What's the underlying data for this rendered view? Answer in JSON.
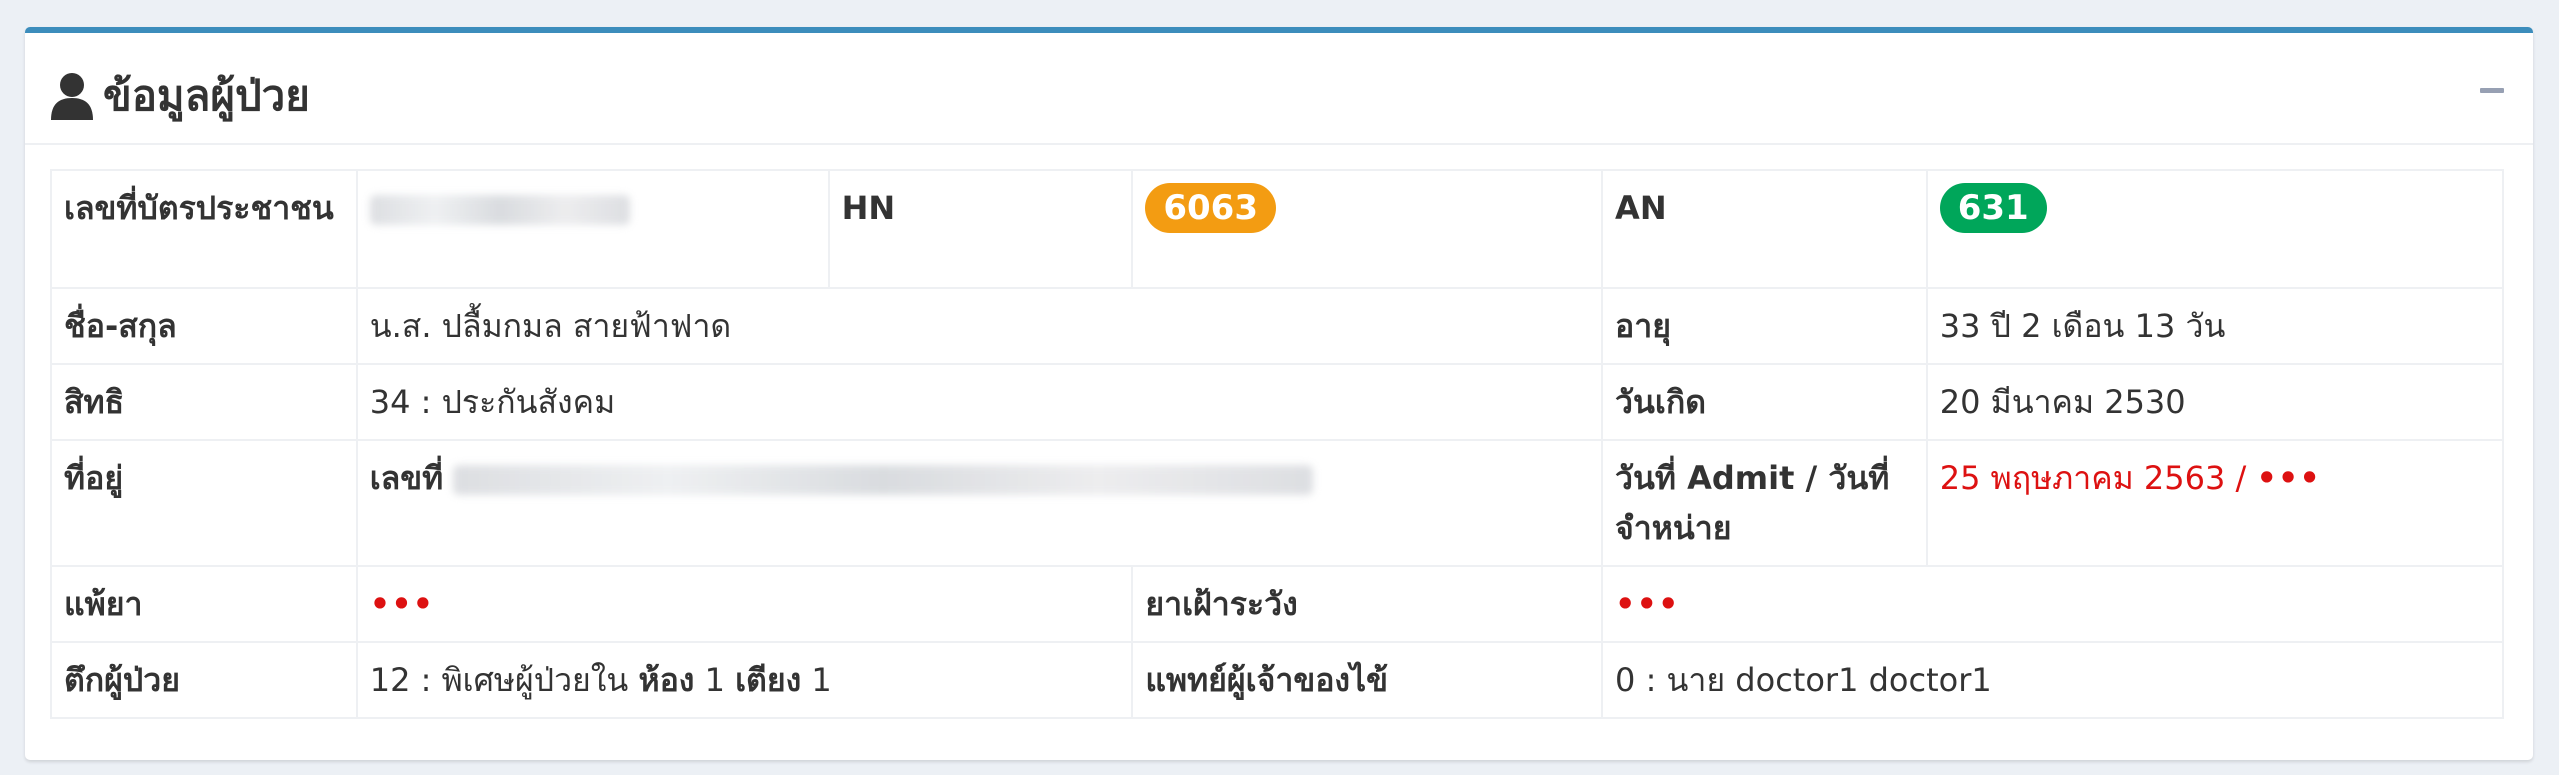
{
  "box": {
    "title": "ข้อมูลผู้ป่วย",
    "title_icon": "user-icon",
    "collapse_icon": "minus-icon"
  },
  "patient": {
    "cid_label": "เลขที่บัตรประชาชน",
    "cid_value": "",
    "hn_label": "HN",
    "hn_value": "6063",
    "an_label": "AN",
    "an_value": "631",
    "name_label": "ชื่อ-สกุล",
    "name_value": "น.ส. ปลื้มกมล สายฟ้าฟาด",
    "age_label": "อายุ",
    "age_value": "33 ปี 2 เดือน 13 วัน",
    "right_label": "สิทธิ",
    "right_value": "34 : ประกันสังคม",
    "birth_label": "วันเกิด",
    "birth_value": "20 มีนาคม 2530",
    "address_label": "ที่อยู่",
    "address_prefix": "เลขที่",
    "admit_label": "วันที่ Admit / วันที่จำหน่าย",
    "admit_value": "25 พฤษภาคม 2563 / ",
    "discharge_value": "•••",
    "allergy_label": "แพ้ยา",
    "allergy_value": "•••",
    "watch_drug_label": "ยาเฝ้าระวัง",
    "watch_drug_value": "•••",
    "ward_label": "ตึกผู้ป่วย",
    "ward_value": "12 : พิเศษผู้ป่วยใน",
    "room_label": "ห้อง",
    "room_value": "1",
    "bed_label": "เตียง",
    "bed_value": "1",
    "doctor_label": "แพทย์ผู้เจ้าของไข้",
    "doctor_value": "0 : นาย doctor1 doctor1"
  },
  "colors": {
    "box_top_border": "#3c8dbc",
    "hn_badge": "#f39c12",
    "an_badge": "#00a65a",
    "alert_text": "#dd1111"
  }
}
